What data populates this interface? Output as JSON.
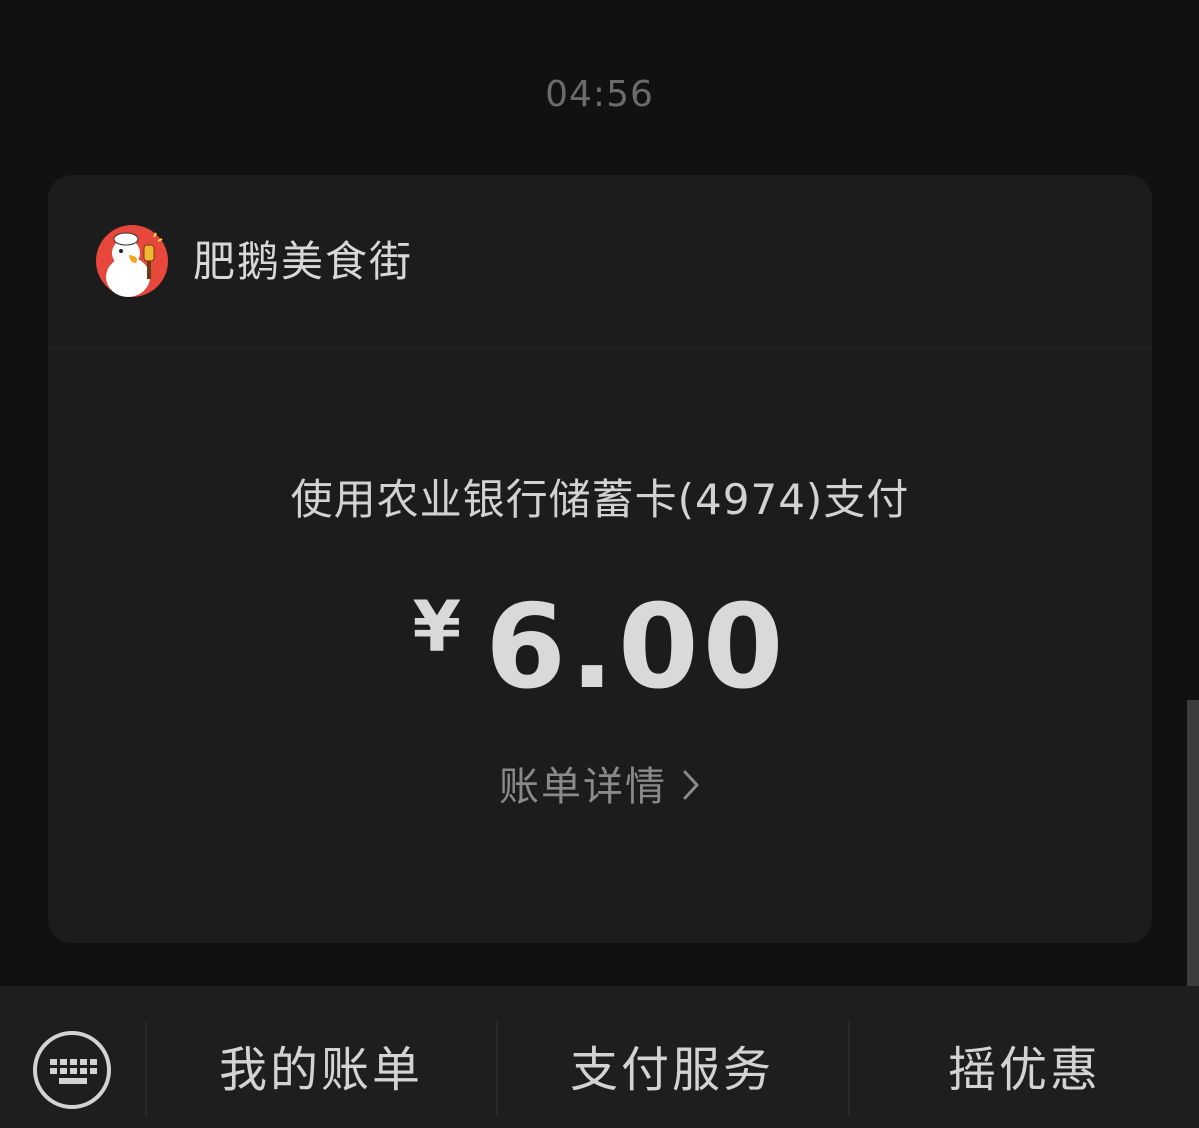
{
  "chat": {
    "timestamp": "04:56"
  },
  "payment_card": {
    "merchant_name": "肥鹅美食街",
    "merchant_avatar_icon": "goose-chef-avatar-icon",
    "payment_method": "使用农业银行储蓄卡(4974)支付",
    "currency_symbol": "¥",
    "amount": "6.00",
    "bill_detail_label": "账单详情",
    "chevron_icon": "chevron-right-icon"
  },
  "bottom_menu": {
    "keyboard_icon": "keyboard-icon",
    "items": [
      {
        "label": "我的账单"
      },
      {
        "label": "支付服务"
      },
      {
        "label": "摇优惠"
      }
    ]
  },
  "colors": {
    "background": "#111111",
    "card": "#1c1c1c",
    "bottom_bar": "#1e1e1e",
    "avatar_red": "#e8473c"
  }
}
